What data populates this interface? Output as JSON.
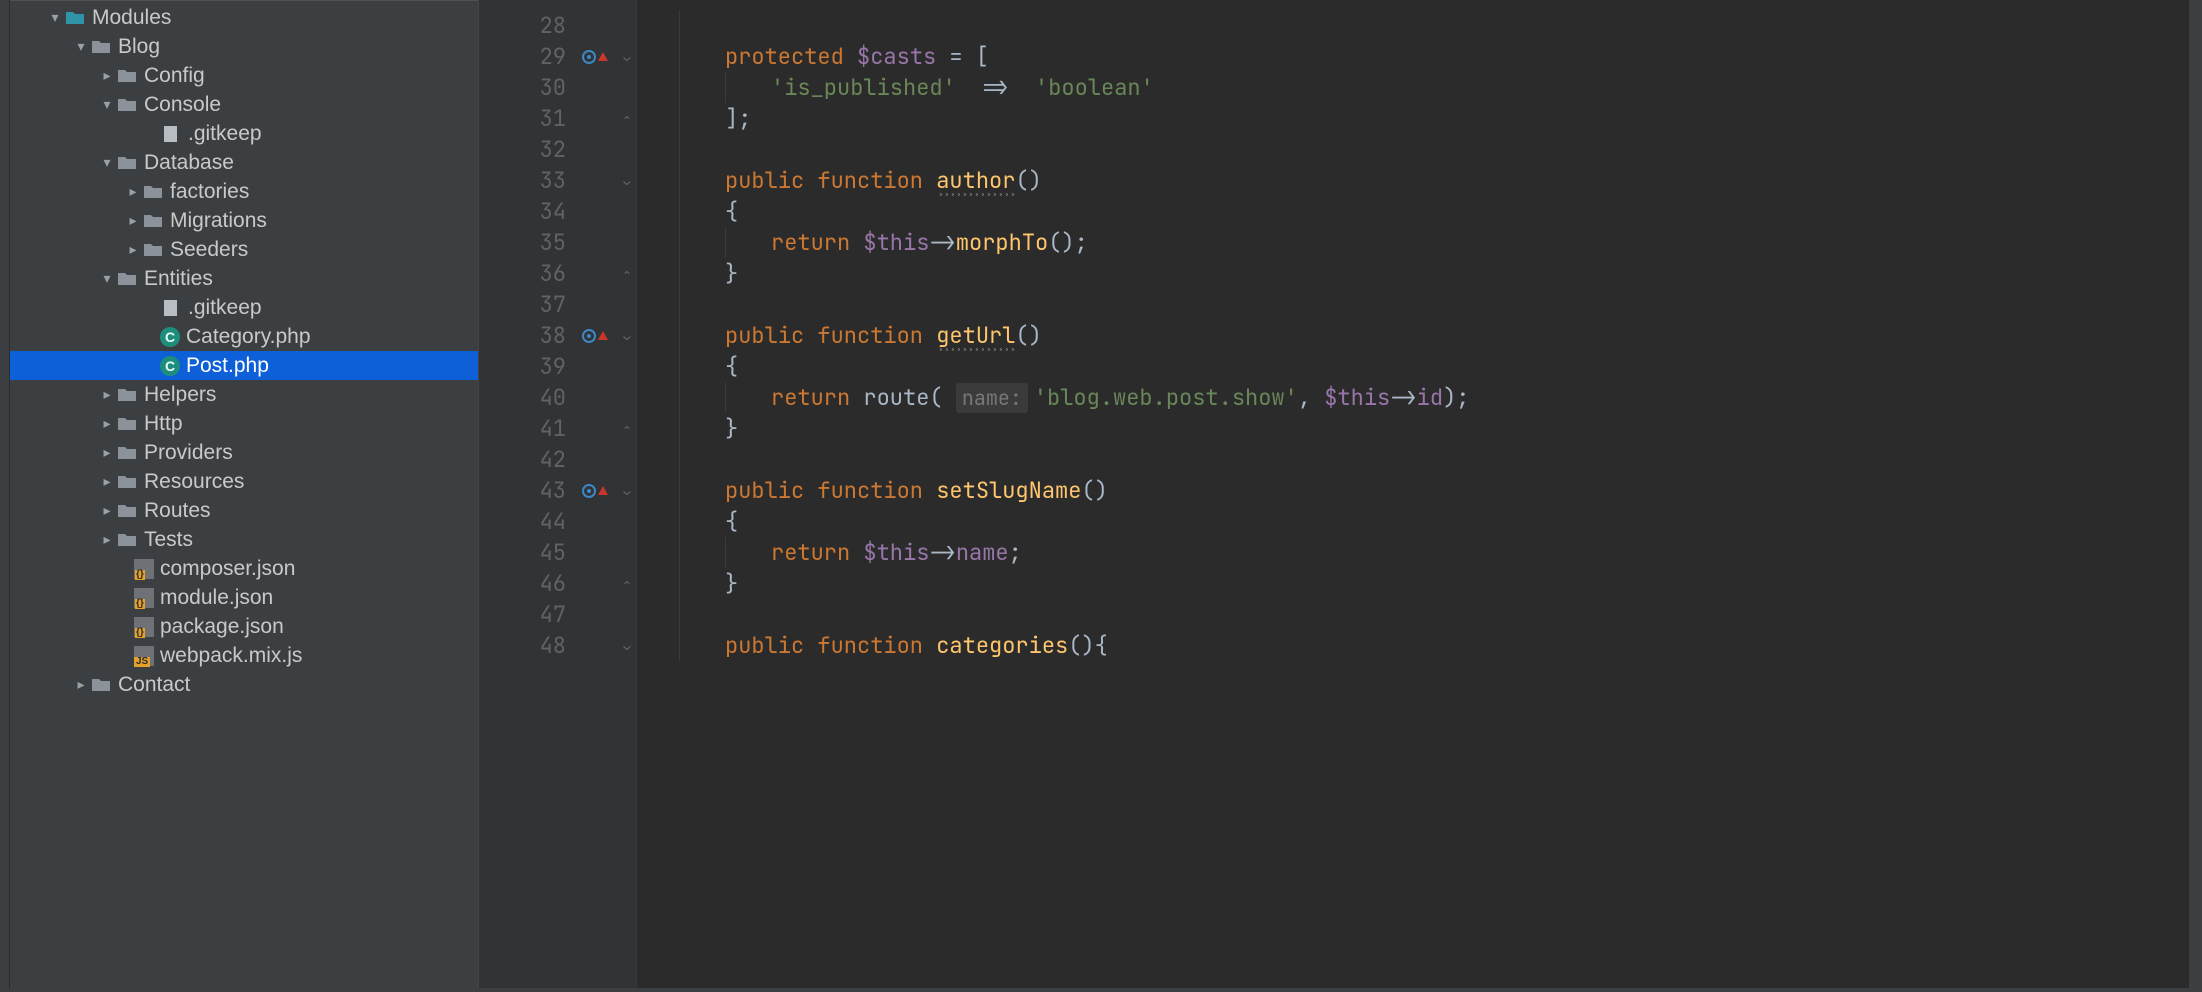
{
  "tree": {
    "modules": {
      "label": "Modules"
    },
    "blog": {
      "label": "Blog"
    },
    "config": {
      "label": "Config"
    },
    "console": {
      "label": "Console"
    },
    "gitkeep1": {
      "label": ".gitkeep"
    },
    "database": {
      "label": "Database"
    },
    "factories": {
      "label": "factories"
    },
    "migrations": {
      "label": "Migrations"
    },
    "seeders": {
      "label": "Seeders"
    },
    "entities": {
      "label": "Entities"
    },
    "gitkeep2": {
      "label": ".gitkeep"
    },
    "category": {
      "label": "Category.php"
    },
    "post": {
      "label": "Post.php"
    },
    "helpers": {
      "label": "Helpers"
    },
    "http": {
      "label": "Http"
    },
    "providers": {
      "label": "Providers"
    },
    "resources": {
      "label": "Resources"
    },
    "routes": {
      "label": "Routes"
    },
    "tests": {
      "label": "Tests"
    },
    "composer": {
      "label": "composer.json"
    },
    "modulejson": {
      "label": "module.json"
    },
    "package": {
      "label": "package.json"
    },
    "webpack": {
      "label": "webpack.mix.js"
    },
    "contact": {
      "label": "Contact"
    }
  },
  "gutter": {
    "start": 28,
    "end": 48
  },
  "code": {
    "kw_protected": "protected",
    "kw_public": "public",
    "kw_function": "function",
    "kw_return": "return",
    "var_casts": "$casts",
    "var_this": "$this",
    "fn_author": "author",
    "fn_getUrl": "getUrl",
    "fn_setSlugName": "setSlugName",
    "fn_categories": "categories",
    "fn_morphTo": "morphTo",
    "fn_route": "route",
    "fld_name": "name",
    "fld_id": "id",
    "str_is_published": "'is_published'",
    "str_boolean": "'boolean'",
    "str_route": "'blog.web.post.show'",
    "hint_name": "name:",
    "op_fat_arrow": "=>",
    "op_eq": "=",
    "op_arrow": "->",
    "br_open": "[",
    "br_close_semi": "];",
    "paren_open_close": "()",
    "brace_open": "{",
    "brace_close": "}",
    "paren_open": "(",
    "paren_close_semi": ");",
    "semi": ";",
    "comma": ","
  }
}
